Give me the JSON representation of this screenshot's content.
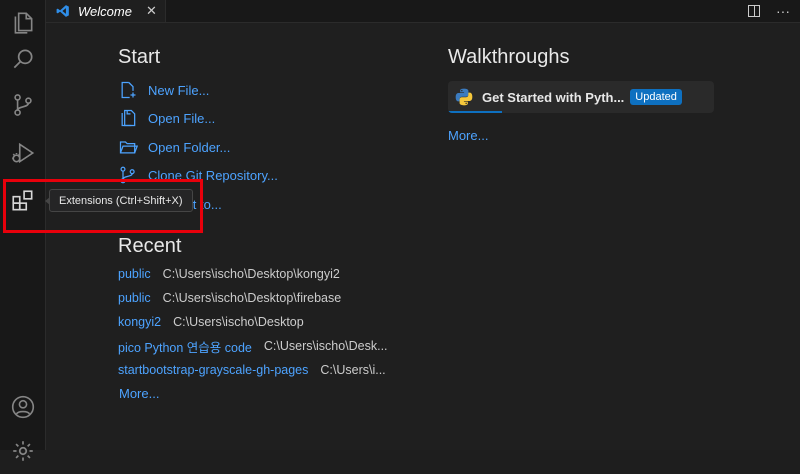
{
  "tab": {
    "label": "Welcome",
    "close": "✕",
    "more": "···"
  },
  "activity": {
    "explorer": "files-icon",
    "search": "search-icon",
    "scm": "source-control-icon",
    "run": "run-debug-icon",
    "extensions": "extensions-icon",
    "accounts": "account-icon",
    "manage": "gear-icon"
  },
  "start": {
    "title": "Start",
    "items": [
      {
        "label": "New File...",
        "icon": "new-file-icon"
      },
      {
        "label": "Open File...",
        "icon": "open-file-icon"
      },
      {
        "label": "Open Folder...",
        "icon": "open-folder-icon"
      },
      {
        "label": "Clone Git Repository...",
        "icon": "git-clone-icon"
      },
      {
        "label": "Connect to...",
        "icon": "remote-icon"
      }
    ]
  },
  "recent": {
    "title": "Recent",
    "items": [
      {
        "name": "public",
        "path": "C:\\Users\\ischo\\Desktop\\kongyi2"
      },
      {
        "name": "public",
        "path": "C:\\Users\\ischo\\Desktop\\firebase"
      },
      {
        "name": "kongyi2",
        "path": "C:\\Users\\ischo\\Desktop"
      },
      {
        "name": "pico Python 연습용 code",
        "path": "C:\\Users\\ischo\\Desk..."
      },
      {
        "name": "startbootstrap-grayscale-gh-pages",
        "path": "C:\\Users\\i..."
      }
    ],
    "more": "More..."
  },
  "walkthroughs": {
    "title": "Walkthroughs",
    "card_title": "Get Started with Pyth...",
    "badge": "Updated",
    "more": "More..."
  },
  "tooltip": {
    "text": "Extensions (Ctrl+Shift+X)"
  },
  "colors": {
    "accent": "#4da3ff",
    "badge": "#0e70c0",
    "highlight": "#e8000b"
  }
}
